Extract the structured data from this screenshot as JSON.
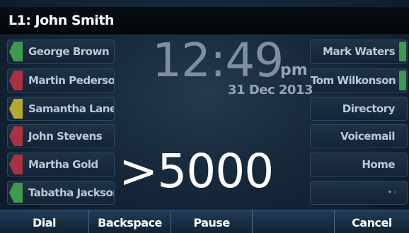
{
  "title_bar": {
    "line_label": "L1: John Smith"
  },
  "left_keys": [
    {
      "label": "George Brown",
      "led_color": "#3f9a4f"
    },
    {
      "label": "Martin Pederson",
      "led_color": "#a83240"
    },
    {
      "label": "Samantha Lane",
      "led_color": "#b6aa2e"
    },
    {
      "label": "John Stevens",
      "led_color": "#a83240"
    },
    {
      "label": "Martha Gold",
      "led_color": "#a83240"
    },
    {
      "label": "Tabatha Jackson",
      "led_color": "#3f9a4f"
    }
  ],
  "right_keys": [
    {
      "label": "Mark Waters",
      "led_color": "#3f9a4f"
    },
    {
      "label": "Tom Wilkonson",
      "led_color": "#3f9a4f"
    },
    {
      "label": "Directory"
    },
    {
      "label": "Voicemail"
    },
    {
      "label": "Home"
    },
    {
      "label": "• ◦"
    }
  ],
  "clock": {
    "time": "12:49",
    "ampm": "pm",
    "date": "31 Dec 2013"
  },
  "dial": {
    "entry": ">5000"
  },
  "softkeys": [
    "Dial",
    "Backspace",
    "Pause",
    "",
    "Cancel"
  ]
}
